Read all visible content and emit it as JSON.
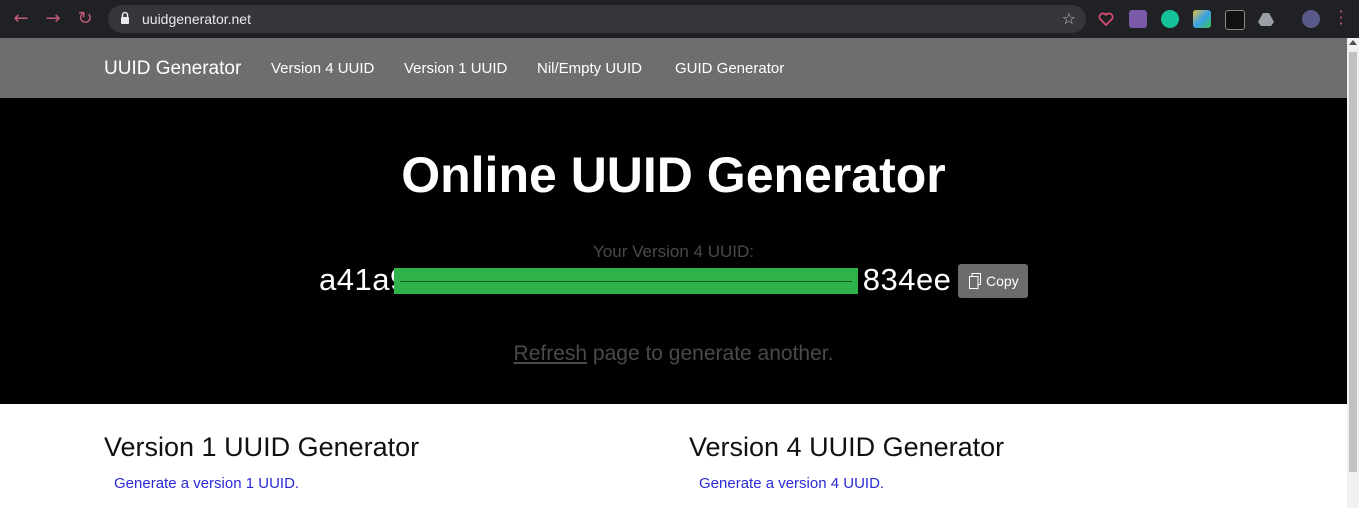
{
  "browser": {
    "url": "uuidgenerator.net",
    "icons": [
      "back-arrow-icon",
      "forward-arrow-icon",
      "reload-icon",
      "lock-icon",
      "star-icon",
      "heart-extension-icon",
      "pdf-extension-icon",
      "grammarly-extension-icon",
      "color-extension-icon",
      "cube-extension-icon",
      "drive-extension-icon",
      "profile-avatar",
      "menu-dots-icon"
    ]
  },
  "site_nav": {
    "brand": "UUID Generator",
    "links": [
      "Version 4 UUID",
      "Version 1 UUID",
      "Nil/Empty UUID",
      "GUID Generator"
    ]
  },
  "hero": {
    "title": "Online UUID Generator",
    "uuid_label": "Your Version 4 UUID:",
    "uuid_visible": "a41a9",
    "uuid_visible_end": "834ee",
    "copy_label": "Copy",
    "refresh_link": "Refresh",
    "refresh_rest": " page to generate another."
  },
  "sections": [
    {
      "title": "Version 1 UUID Generator",
      "link": "Generate a version 1 UUID."
    },
    {
      "title": "Version 4 UUID Generator",
      "link": "Generate a version 4 UUID."
    }
  ],
  "colors": {
    "chrome": "#202124",
    "nav_bg": "#6e6e6e",
    "hero_bg": "#000000",
    "redaction": "#2db34a",
    "link": "#2a2ad8"
  }
}
